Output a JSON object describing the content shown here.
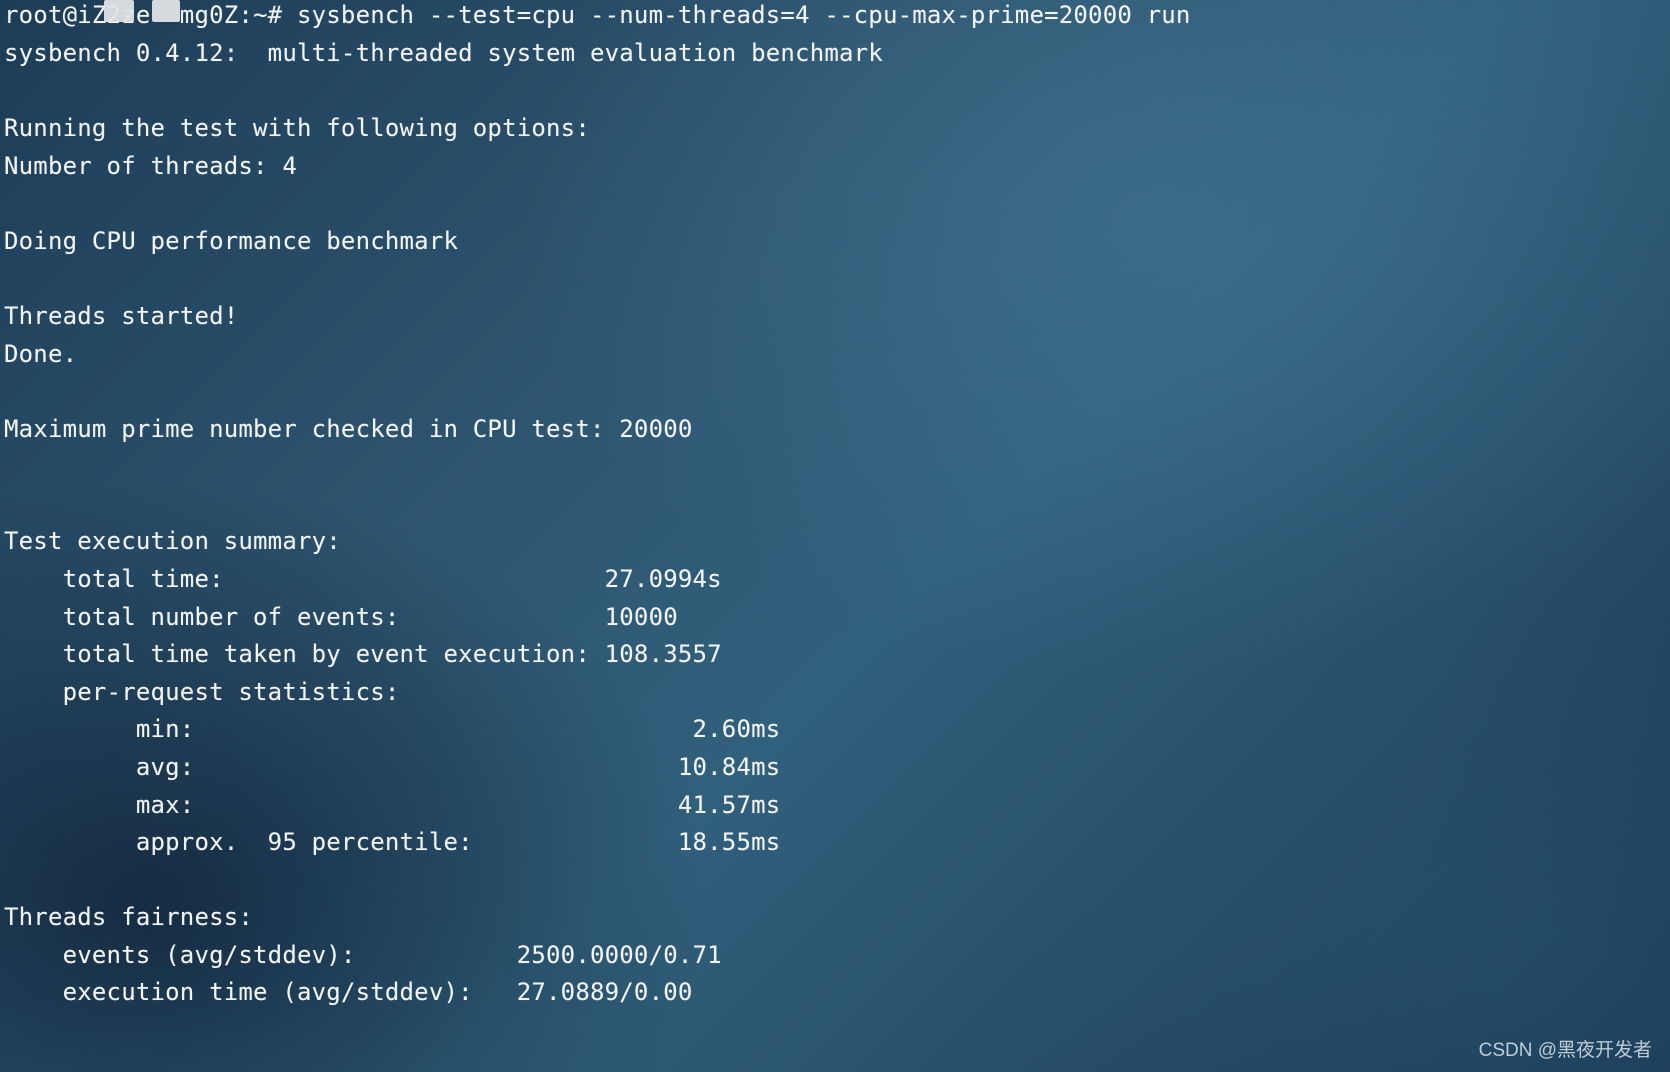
{
  "terminal": {
    "lines": [
      "root@iZ2ze  mg0Z:~# sysbench --test=cpu --num-threads=4 --cpu-max-prime=20000 run",
      "sysbench 0.4.12:  multi-threaded system evaluation benchmark",
      "Running the test with following options:",
      "Number of threads: 4",
      "Doing CPU performance benchmark",
      "Threads started!",
      "Done.",
      "Maximum prime number checked in CPU test: 20000",
      "Test execution summary:",
      "    total time:                          27.0994s",
      "    total number of events:              10000",
      "    total time taken by event execution: 108.3557",
      "    per-request statistics:",
      "         min:                                  2.60ms",
      "         avg:                                 10.84ms",
      "         max:                                 41.57ms",
      "         approx.  95 percentile:              18.55ms",
      "Threads fairness:",
      "    events (avg/stddev):           2500.0000/0.71",
      "    execution time (avg/stddev):   27.0889/0.00"
    ]
  },
  "watermark": "CSDN @黑夜开发者"
}
